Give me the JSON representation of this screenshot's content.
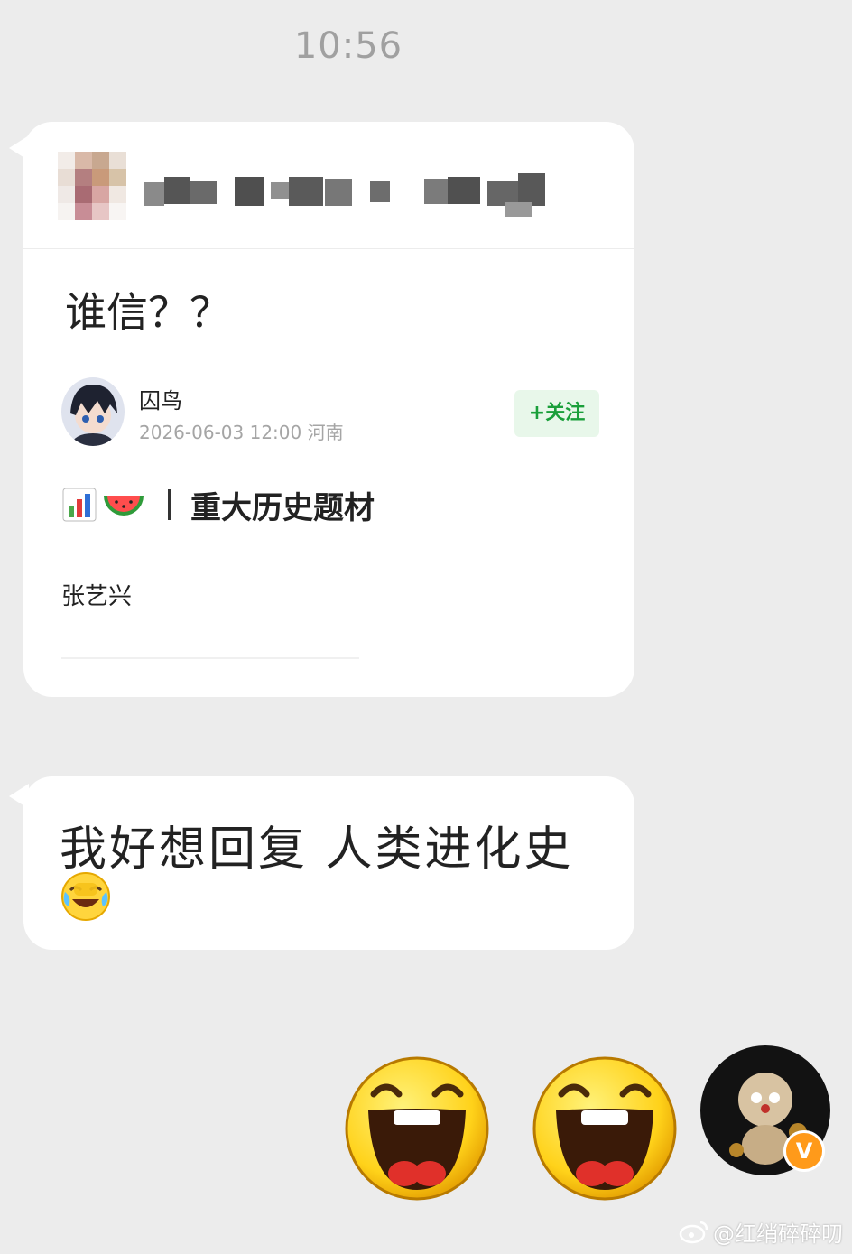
{
  "status": {
    "time": "10:56"
  },
  "shared_card": {
    "title": "谁信？？",
    "author": {
      "name": "囚鸟",
      "meta": "2026-06-03 12:00  河南"
    },
    "follow_label": "+关注",
    "topic_icons": [
      "bar-chart-icon",
      "watermelon-icon"
    ],
    "topic": "重大历史题材",
    "body": "张艺兴"
  },
  "message": {
    "text": "我好想回复  人类进化史",
    "emoji": "laugh-cry-icon"
  },
  "sticker_icons": [
    "laughing-face-icon",
    "laughing-face-icon"
  ],
  "self": {
    "verified_badge": "V"
  },
  "watermark": {
    "text": "@红绡碎碎叨"
  },
  "colors": {
    "background": "#ececec",
    "bubble": "#ffffff",
    "follow_green": "#1a9f3a",
    "badge_orange": "#ff9a1a"
  }
}
